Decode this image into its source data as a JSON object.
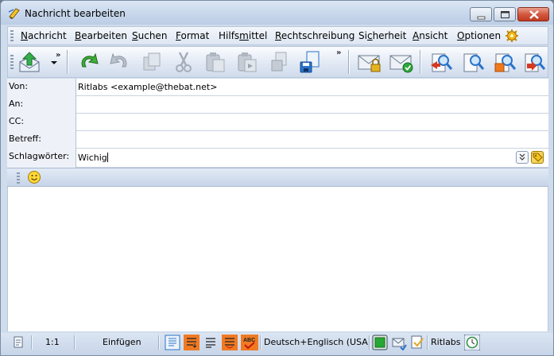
{
  "window": {
    "title": "Nachricht bearbeiten"
  },
  "menu": [
    {
      "label": "Nachricht",
      "accel": "N",
      "rest": "achricht"
    },
    {
      "label": "Bearbeiten",
      "accel": "B",
      "rest": "earbeiten"
    },
    {
      "label": "Suchen",
      "accel": "S",
      "rest": "uchen"
    },
    {
      "label": "Format",
      "accel": "F",
      "rest": "ormat"
    },
    {
      "label": "Hilfsmittel",
      "pre": "Hilfs",
      "accel": "m",
      "rest": "ittel"
    },
    {
      "label": "Rechtschreibung",
      "accel": "R",
      "rest": "echtschreibung"
    },
    {
      "label": "Sicherheit",
      "pre": "Si",
      "accel": "c",
      "rest": "herheit"
    },
    {
      "label": "Ansicht",
      "accel": "A",
      "rest": "nsicht"
    },
    {
      "label": "Optionen",
      "accel": "O",
      "rest": "ptionen"
    }
  ],
  "toolbar": {
    "overflow": "»",
    "icons": [
      "send-icon",
      "undo-icon",
      "redo-icon",
      "copy-icon",
      "cut-icon",
      "paste-icon",
      "paste-quoted-icon",
      "save-draft-icon",
      "new-document-icon",
      "encrypt-icon",
      "sign-icon",
      "address-book-to-icon",
      "address-book-icon",
      "address-book-cc-icon",
      "address-book-forward-icon"
    ]
  },
  "fields": {
    "from": {
      "label": "Von:",
      "value": "Ritlabs <example@thebat.net>"
    },
    "to": {
      "label": "An:",
      "value": ""
    },
    "cc": {
      "label": "CC:",
      "value": ""
    },
    "subject": {
      "label": "Betreff:",
      "value": ""
    },
    "keywords": {
      "label": "Schlagwörter:",
      "value": "Wichig"
    }
  },
  "status": {
    "position": "1:1",
    "mode": "Einfügen",
    "language": "Deutsch+Englisch (USA)",
    "account": "Ritlabs"
  },
  "colors": {
    "window_bg": "#cfdcec",
    "highlight_orange": "#f07a22",
    "accent_blue": "#2a73c9"
  }
}
